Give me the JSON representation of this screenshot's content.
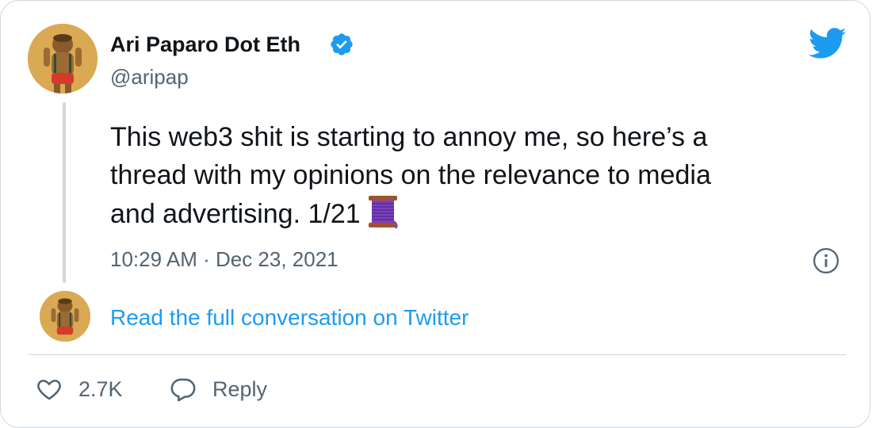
{
  "author": {
    "name": "Ari Paparo Dot Eth",
    "handle": "@aripap",
    "verified": true
  },
  "tweet": {
    "lines": [
      "This web3 shit is starting to annoy me, so here’s a",
      "thread with my opinions on the relevance to media",
      "and advertising. 1/21"
    ],
    "emoji": "spool-of-thread",
    "timestamp": "10:29 AM · Dec 23, 2021"
  },
  "conversation_link": "Read the full conversation on Twitter",
  "actions": {
    "like_count": "2.7K",
    "reply_label": "Reply"
  },
  "colors": {
    "link": "#1d9bf0",
    "verified": "#1d9bf0",
    "secondary_text": "#536471",
    "border": "#cfd9de"
  },
  "icons": [
    "twitter-bird-icon",
    "verified-badge-icon",
    "info-icon",
    "heart-icon",
    "reply-bubble-icon",
    "spool-emoji"
  ]
}
